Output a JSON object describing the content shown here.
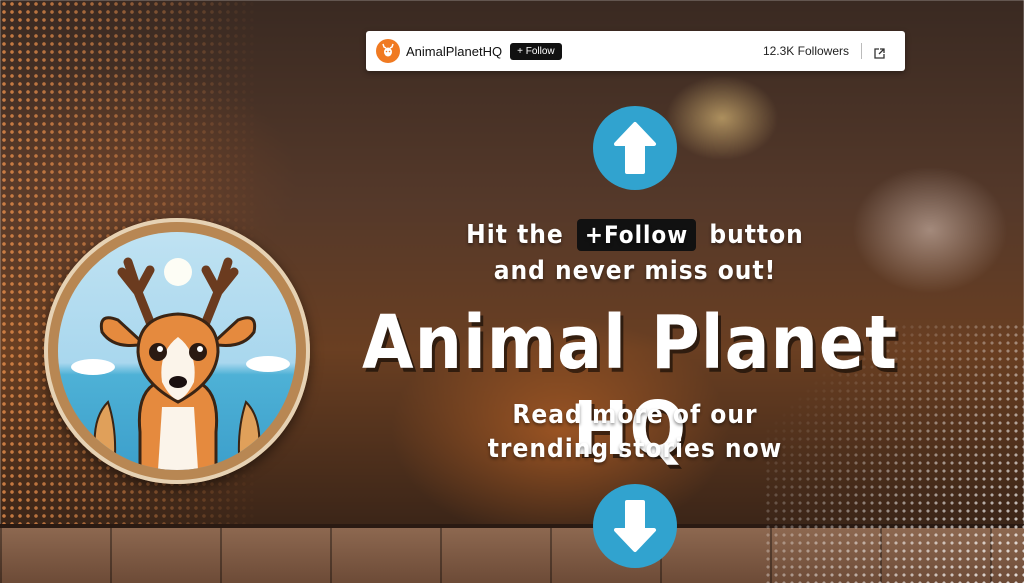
{
  "topbar": {
    "brand": "AnimalPlanetHQ",
    "follow_label": "+ Follow",
    "followers": "12.3K Followers"
  },
  "promo": {
    "line1_pre": "Hit the",
    "line1_pill": "+Follow",
    "line1_post": "button",
    "line2": "and never miss out!",
    "title": "Animal Planet HQ",
    "line3": "Read more of our",
    "line4": "trending stories now"
  },
  "colors": {
    "arrow": "#31a3cf",
    "brand": "#f07a22"
  },
  "icons": {
    "up": "arrow-up-icon",
    "down": "arrow-down-icon",
    "external": "external-link-icon"
  }
}
